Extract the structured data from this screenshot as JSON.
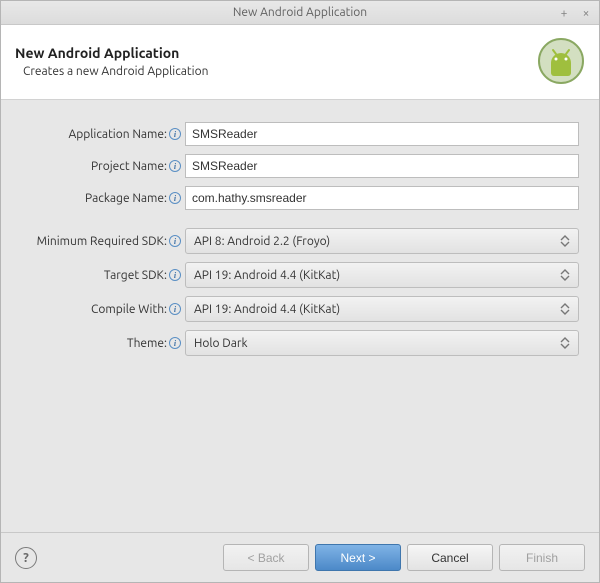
{
  "window": {
    "title": "New Android Application"
  },
  "banner": {
    "heading": "New Android Application",
    "subtitle": "Creates a new Android Application"
  },
  "labels": {
    "app_name": "Application Name:",
    "project_name": "Project Name:",
    "package_name": "Package Name:",
    "min_sdk": "Minimum Required SDK:",
    "target_sdk": "Target SDK:",
    "compile_with": "Compile With:",
    "theme": "Theme:"
  },
  "values": {
    "app_name": "SMSReader",
    "project_name": "SMSReader",
    "package_name": "com.hathy.smsreader",
    "min_sdk": "API 8: Android 2.2 (Froyo)",
    "target_sdk": "API 19: Android 4.4 (KitKat)",
    "compile_with": "API 19: Android 4.4 (KitKat)",
    "theme": "Holo Dark"
  },
  "buttons": {
    "back": "< Back",
    "next": "Next >",
    "cancel": "Cancel",
    "finish": "Finish"
  }
}
